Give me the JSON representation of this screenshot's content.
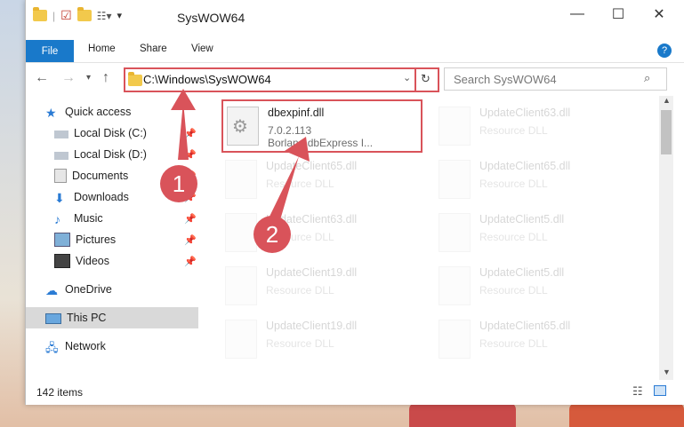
{
  "window": {
    "title": "SysWOW64"
  },
  "ribbon": {
    "tabs": [
      "File",
      "Home",
      "Share",
      "View"
    ]
  },
  "address": {
    "path": "C:\\Windows\\SysWOW64"
  },
  "search": {
    "placeholder": "Search SysWOW64"
  },
  "nav": {
    "items": [
      {
        "label": "Quick access",
        "icon": "star-icon",
        "pinned": false
      },
      {
        "label": "Local Disk (C:)",
        "icon": "drive-icon",
        "pinned": true
      },
      {
        "label": "Local Disk (D:)",
        "icon": "drive-icon",
        "pinned": true
      },
      {
        "label": "Documents",
        "icon": "documents-icon",
        "pinned": true
      },
      {
        "label": "Downloads",
        "icon": "download-icon",
        "pinned": true
      },
      {
        "label": "Music",
        "icon": "music-icon",
        "pinned": true
      },
      {
        "label": "Pictures",
        "icon": "pictures-icon",
        "pinned": true
      },
      {
        "label": "Videos",
        "icon": "videos-icon",
        "pinned": true
      },
      {
        "label": "OneDrive",
        "icon": "cloud-icon",
        "pinned": false
      },
      {
        "label": "This PC",
        "icon": "computer-icon",
        "pinned": false
      },
      {
        "label": "Network",
        "icon": "network-icon",
        "pinned": false
      }
    ]
  },
  "files": {
    "highlighted": {
      "name": "dbexpinf.dll",
      "version": "7.0.2.113",
      "description": "Borland dbExpress I..."
    },
    "others": [
      {
        "name": "UpdateClient63.dll",
        "type": "Resource DLL"
      },
      {
        "name": "UpdateClient65.dll",
        "type": "Resource DLL"
      },
      {
        "name": "UpdateClient65.dll",
        "type": "Resource DLL"
      },
      {
        "name": "UpdateClient63.dll",
        "type": "Resource DLL"
      },
      {
        "name": "UpdateClient5.dll",
        "type": "Resource DLL"
      },
      {
        "name": "UpdateClient19.dll",
        "type": "Resource DLL"
      },
      {
        "name": "UpdateClient5.dll",
        "type": "Resource DLL"
      },
      {
        "name": "UpdateClient19.dll",
        "type": "Resource DLL"
      },
      {
        "name": "UpdateClient65.dll",
        "type": "Resource DLL"
      }
    ]
  },
  "status": {
    "count": "142 items"
  },
  "annotations": {
    "step1": "1",
    "step2": "2"
  },
  "colors": {
    "accent": "#1979ca",
    "highlight": "#d9535a"
  }
}
